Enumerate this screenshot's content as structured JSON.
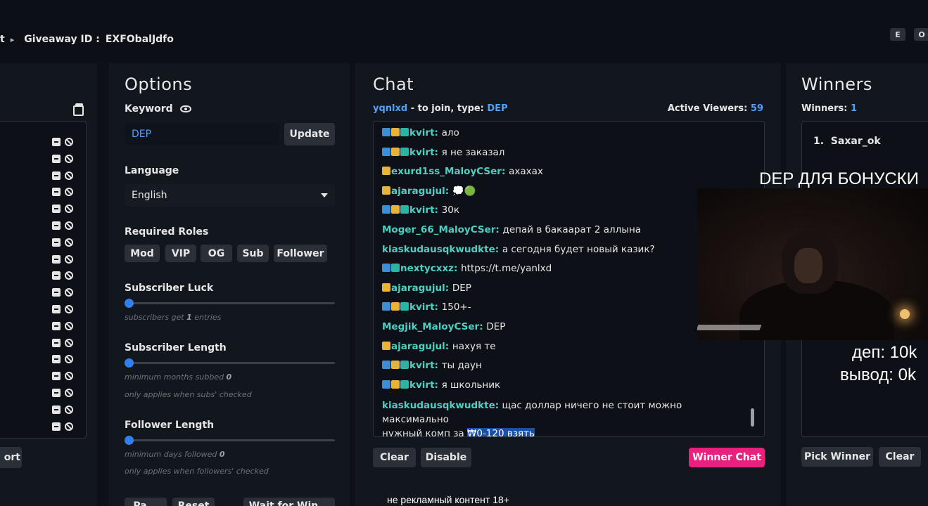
{
  "breadcrumb": {
    "prev_fragment": "t",
    "label": "Giveaway ID :",
    "id": "EXFObalJdfo"
  },
  "top_buttons": [
    "E",
    "O"
  ],
  "left": {
    "export_label": "ort",
    "row_count": 18
  },
  "options": {
    "title": "Options",
    "keyword_label": "Keyword",
    "keyword_value": "DEP",
    "update_label": "Update",
    "language_label": "Language",
    "language_value": "English",
    "roles_label": "Required Roles",
    "roles": [
      "Mod",
      "VIP",
      "OG",
      "Sub",
      "Follower"
    ],
    "sub_luck_label": "Subscriber Luck",
    "sub_luck_hint_pre": "subscribers get",
    "sub_luck_value": "1",
    "sub_luck_hint_post": "entries",
    "sub_length_label": "Subscriber Length",
    "sub_length_hint_pre": "minimum months subbed",
    "sub_length_value": "0",
    "sub_length_note": "only applies when subs' checked",
    "follow_label": "Follower Length",
    "follow_hint_pre": "minimum days followed",
    "follow_value": "0",
    "follow_note": "only applies when followers' checked",
    "bottom_buttons": [
      "Pa...",
      "Reset",
      "Wait for Win..."
    ]
  },
  "chat": {
    "title": "Chat",
    "channel": "yqnlxd",
    "join_text": "- to join, type:",
    "join_keyword": "DEP",
    "viewers_label": "Active Viewers:",
    "viewers_count": "59",
    "messages": [
      {
        "user": "kvirt",
        "badges": [
          "blue",
          "gold",
          "teal"
        ],
        "text": "ало"
      },
      {
        "user": "kvirt",
        "badges": [
          "blue",
          "gold",
          "teal"
        ],
        "text": "я не заказал"
      },
      {
        "user": "exurd1ss_MaloyCSer",
        "badges": [
          "gold"
        ],
        "text": "ахахах"
      },
      {
        "user": "ajaragujul",
        "badges": [
          "gold"
        ],
        "text": "💭🟢"
      },
      {
        "user": "kvirt",
        "badges": [
          "blue",
          "gold",
          "teal"
        ],
        "text": "30к"
      },
      {
        "user": "Moger_66_MaloyCSer",
        "badges": [],
        "text": "депай в бакаарат 2 аллына"
      },
      {
        "user": "kiaskudausqkwudkte",
        "badges": [],
        "text": "а сегодня будет новый казик?"
      },
      {
        "user": "nextycxxz",
        "badges": [
          "blue",
          "teal"
        ],
        "text": "https://t.me/yanlxd"
      },
      {
        "user": "ajaragujul",
        "badges": [
          "gold"
        ],
        "text": "DEP"
      },
      {
        "user": "kvirt",
        "badges": [
          "blue",
          "gold",
          "teal"
        ],
        "text": "150+-"
      },
      {
        "user": "Megjik_MaloyCSer",
        "badges": [],
        "text": "DEP"
      },
      {
        "user": "ajaragujul",
        "badges": [
          "gold"
        ],
        "text": "нахуя те"
      },
      {
        "user": "kvirt",
        "badges": [
          "blue",
          "gold",
          "teal"
        ],
        "text": "ты даун"
      },
      {
        "user": "kvirt",
        "badges": [
          "blue",
          "gold",
          "teal"
        ],
        "text": "я школьник"
      }
    ],
    "last_message": {
      "user": "kiaskudausqkwudkte",
      "text_line1": "щас доллар ничего не стоит можно максимально",
      "text_line2_pre": "нужный комп за",
      "text_line2_hl": "₩0-120 взять"
    },
    "clear_label": "Clear",
    "disable_label": "Disable",
    "winner_chat_label": "Winner Chat"
  },
  "winners": {
    "title": "Winners",
    "count_label": "Winners:",
    "count": "1",
    "list": [
      "1.  Saxar_ok"
    ],
    "pick_label": "Pick Winner",
    "clear_label": "Clear"
  },
  "overlay": {
    "banner": "DEP ДЛЯ БОНУСКИ",
    "dep_line": "деп: 10k",
    "withdraw_line": "вывод: 0k",
    "footer": "не рекламный контент 18+"
  }
}
